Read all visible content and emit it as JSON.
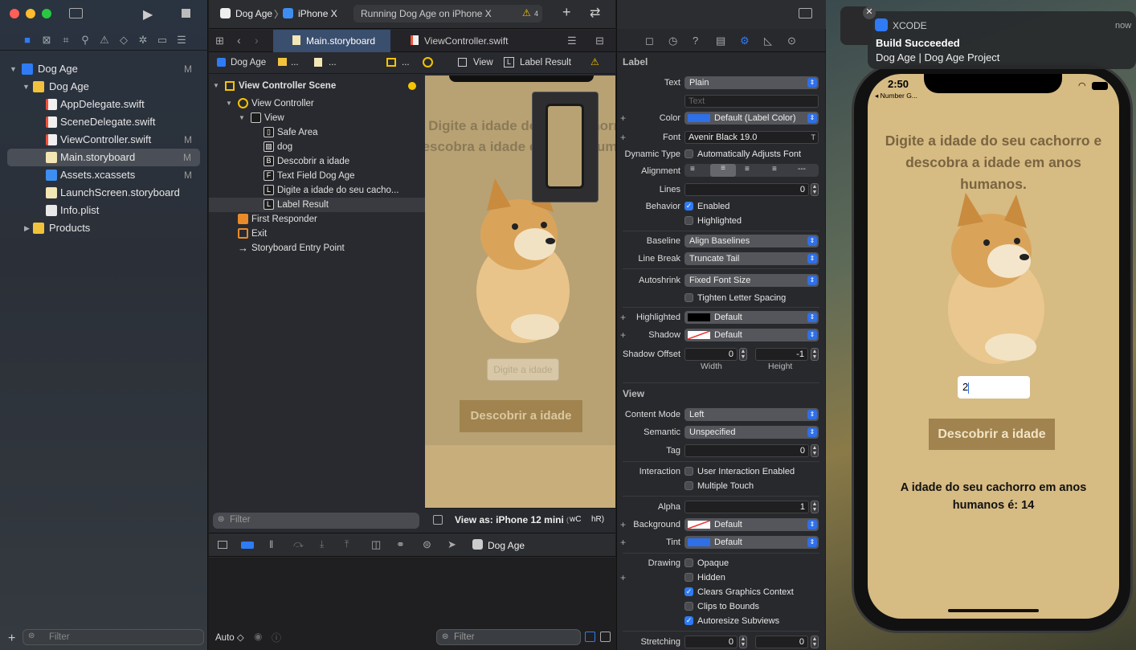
{
  "navigator": {
    "items": [
      {
        "label": "Dog Age",
        "badge": "M"
      },
      {
        "label": "Dog Age",
        "badge": ""
      },
      {
        "label": "AppDelegate.swift",
        "badge": ""
      },
      {
        "label": "SceneDelegate.swift",
        "badge": ""
      },
      {
        "label": "ViewController.swift",
        "badge": "M"
      },
      {
        "label": "Main.storyboard",
        "badge": "M"
      },
      {
        "label": "Assets.xcassets",
        "badge": "M"
      },
      {
        "label": "LaunchScreen.storyboard",
        "badge": ""
      },
      {
        "label": "Info.plist",
        "badge": ""
      },
      {
        "label": "Products",
        "badge": ""
      }
    ],
    "filter_placeholder": "Filter"
  },
  "toolbar": {
    "scheme": "Dog Age",
    "device": "iPhone X",
    "status": "Running Dog Age on iPhone X",
    "warnings": "4"
  },
  "tabs": [
    {
      "label": "Main.storyboard"
    },
    {
      "label": "ViewController.swift"
    }
  ],
  "jumpbar": {
    "root": "Dog Age",
    "dots1": "...",
    "dots2": "...",
    "dots3": "...",
    "view": "View",
    "result": "Label Result"
  },
  "outline": {
    "rows": [
      {
        "label": "View Controller Scene",
        "icon": ""
      },
      {
        "label": "View Controller",
        "icon": ""
      },
      {
        "label": "View",
        "icon": ""
      },
      {
        "label": "Safe Area",
        "icon": "▯"
      },
      {
        "label": "dog",
        "icon": ""
      },
      {
        "label": "Descobrir a idade",
        "icon": "B"
      },
      {
        "label": "Text Field Dog Age",
        "icon": "F"
      },
      {
        "label": "Digite a idade do seu cacho...",
        "icon": "L"
      },
      {
        "label": "Label Result",
        "icon": "L"
      },
      {
        "label": "First Responder",
        "icon": ""
      },
      {
        "label": "Exit",
        "icon": ""
      },
      {
        "label": "Storyboard Entry Point",
        "icon": ""
      }
    ],
    "filter_placeholder": "Filter"
  },
  "canvas": {
    "heading": "Digite a idade do seu cachorro e descobra a idade em anos humanos.",
    "textfield_placeholder": "Digite a idade",
    "button": "Descobrir a idade",
    "view_as": "View as: iPhone 12 mini",
    "size_class_w": "wC",
    "size_class_h": "hR)"
  },
  "debug": {
    "target": "Dog Age",
    "auto": "Auto ◇",
    "filter_placeholder": "Filter"
  },
  "inspector": {
    "label_title": "Label",
    "text_label": "Text",
    "text_value": "Plain",
    "text_placeholder": "Text",
    "color_label": "Color",
    "color_value": "Default (Label Color)",
    "font_label": "Font",
    "font_value": "Avenir Black 19.0",
    "dynamic_label": "Dynamic Type",
    "dynamic_value": "Automatically Adjusts Font",
    "alignment_label": "Alignment",
    "lines_label": "Lines",
    "lines_value": "0",
    "behavior_label": "Behavior",
    "enabled": "Enabled",
    "highlighted": "Highlighted",
    "baseline_label": "Baseline",
    "baseline_value": "Align Baselines",
    "linebreak_label": "Line Break",
    "linebreak_value": "Truncate Tail",
    "autoshrink_label": "Autoshrink",
    "autoshrink_value": "Fixed Font Size",
    "tighten": "Tighten Letter Spacing",
    "hl_label": "Highlighted",
    "hl_value": "Default",
    "shadow_label": "Shadow",
    "shadow_value": "Default",
    "shadow_offset_label": "Shadow Offset",
    "offset_w": "0",
    "offset_h": "-1",
    "width_caption": "Width",
    "height_caption": "Height",
    "view_title": "View",
    "content_mode_label": "Content Mode",
    "content_mode_value": "Left",
    "semantic_label": "Semantic",
    "semantic_value": "Unspecified",
    "tag_label": "Tag",
    "tag_value": "0",
    "interaction_label": "Interaction",
    "user_interaction": "User Interaction Enabled",
    "multiple_touch": "Multiple Touch",
    "alpha_label": "Alpha",
    "alpha_value": "1",
    "background_label": "Background",
    "background_value": "Default",
    "tint_label": "Tint",
    "tint_value": "Default",
    "drawing_label": "Drawing",
    "opaque": "Opaque",
    "hidden": "Hidden",
    "clears": "Clears Graphics Context",
    "clips": "Clips to Bounds",
    "autoresize": "Autoresize Subviews",
    "stretching_label": "Stretching",
    "stretch_x": "0",
    "stretch_y": "0"
  },
  "notification": {
    "app": "XCODE",
    "time": "now",
    "title": "Build Succeeded",
    "body": "Dog Age | Dog Age Project"
  },
  "simulator": {
    "time": "2:50",
    "back": "◂ Number G...",
    "heading": "Digite a idade do seu cachorro e descobra a idade em anos humanos.",
    "input_value": "2",
    "button": "Descobrir a idade",
    "result": "A idade do seu cachorro em anos humanos é: 14"
  }
}
